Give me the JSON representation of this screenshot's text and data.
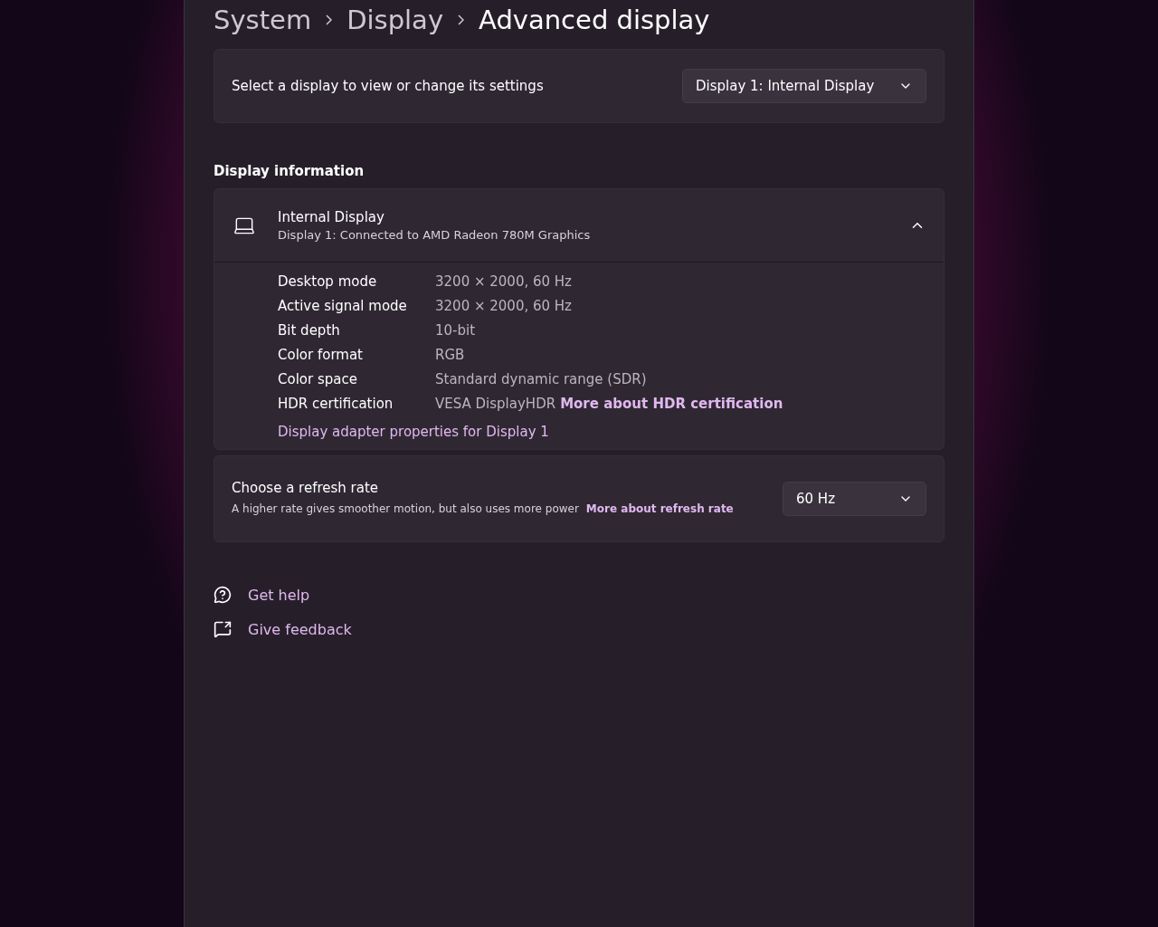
{
  "breadcrumb": [
    "System",
    "Display",
    "Advanced display"
  ],
  "display_select": {
    "label": "Select a display to view or change its settings",
    "value": "Display 1: Internal Display"
  },
  "section_title": "Display information",
  "display_card": {
    "title": "Internal Display",
    "subtitle": "Display 1: Connected to AMD Radeon 780M Graphics",
    "expanded": true,
    "rows": [
      {
        "label": "Desktop mode",
        "value": "3200 × 2000, 60 Hz"
      },
      {
        "label": "Active signal mode",
        "value": "3200 × 2000, 60 Hz"
      },
      {
        "label": "Bit depth",
        "value": "10-bit"
      },
      {
        "label": "Color format",
        "value": "RGB"
      },
      {
        "label": "Color space",
        "value": "Standard dynamic range (SDR)"
      },
      {
        "label": "HDR certification",
        "value": "VESA DisplayHDR",
        "link": "More about HDR certification"
      }
    ],
    "adapter_link": "Display adapter properties for Display 1"
  },
  "refresh": {
    "title": "Choose a refresh rate",
    "description": "A higher rate gives smoother motion, but also uses more power",
    "link": "More about refresh rate",
    "value": "60 Hz"
  },
  "help_links": [
    {
      "kind": "help",
      "label": "Get help"
    },
    {
      "kind": "feedback",
      "label": "Give feedback"
    }
  ]
}
